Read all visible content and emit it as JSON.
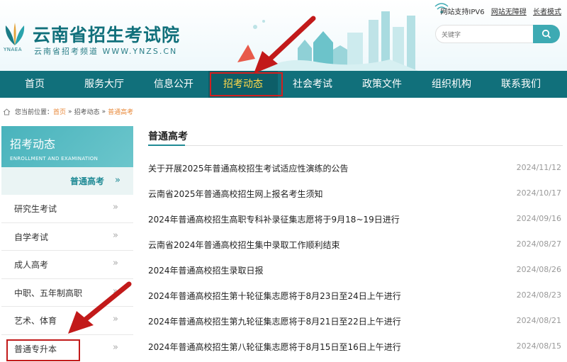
{
  "header": {
    "site_title": "云南省招生考试院",
    "site_subtitle": "云南省招考频道 WWW.YNZS.CN",
    "logo_abbr": "YNAEA",
    "top_links": {
      "ipv6": "网站支持IPV6",
      "accessible": "网站无障碍",
      "elder": "长者模式"
    },
    "search": {
      "placeholder": "关键字"
    }
  },
  "nav": {
    "items": [
      "首页",
      "服务大厅",
      "信息公开",
      "招考动态",
      "社会考试",
      "政策文件",
      "组织机构",
      "联系我们"
    ],
    "active_index": 3
  },
  "breadcrumb": {
    "prefix": "您当前位置：",
    "items": [
      "首页",
      "招考动态",
      "普通高考"
    ],
    "separator": "»"
  },
  "sidebar": {
    "title": "招考动态",
    "title_en": "ENROLLMENT AND EXAMINATION",
    "active_item": "普通高考",
    "arrow": "»",
    "items": [
      "研究生考试",
      "自学考试",
      "成人高考",
      "中职、五年制高职",
      "艺术、体育",
      "普通专升本"
    ],
    "highlighted_index": 5
  },
  "main": {
    "section_title": "普通高考",
    "news": [
      {
        "title": "关于开展2025年普通高校招生考试适应性演练的公告",
        "date": "2024/11/12"
      },
      {
        "title": "云南省2025年普通高校招生网上报名考生须知",
        "date": "2024/10/17"
      },
      {
        "title": "2024年普通高校招生高职专科补录征集志愿将于9月18~19日进行",
        "date": "2024/09/16"
      },
      {
        "title": "云南省2024年普通高校招生集中录取工作顺利结束",
        "date": "2024/08/27"
      },
      {
        "title": "2024年普通高校招生录取日报",
        "date": "2024/08/26"
      },
      {
        "title": "2024年普通高校招生第十轮征集志愿将于8月23日至24日上午进行",
        "date": "2024/08/23"
      },
      {
        "title": "2024年普通高校招生第九轮征集志愿将于8月21日至22日上午进行",
        "date": "2024/08/21"
      },
      {
        "title": "2024年普通高校招生第八轮征集志愿将于8月15日至16日上午进行",
        "date": "2024/08/15"
      }
    ]
  },
  "colors": {
    "primary": "#11707b",
    "accent": "#3daab3",
    "nav_active_text": "#ffd94a",
    "highlight_red": "#c21a1a",
    "breadcrumb_orange": "#e8893a"
  }
}
